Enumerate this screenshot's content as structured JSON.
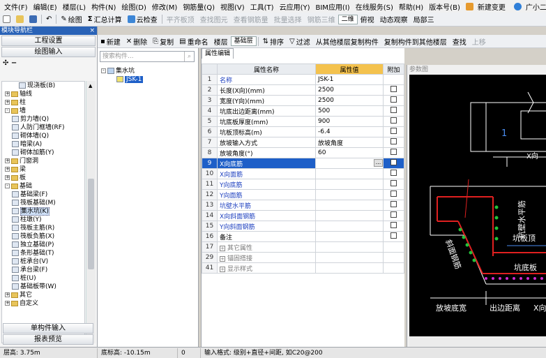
{
  "menu": {
    "items": [
      "文件(F)",
      "编辑(E)",
      "楼层(L)",
      "构件(N)",
      "绘图(D)",
      "修改(M)",
      "钢筋量(Q)",
      "视图(V)",
      "工具(T)",
      "云应用(Y)",
      "BIM应用(I)",
      "在线服务(S)",
      "帮助(H)",
      "版本号(B)"
    ],
    "new_change": "新建变更",
    "user": "广小二"
  },
  "toolbar1": {
    "draw": "绘图",
    "summary": "汇总计算",
    "cloud_check": "云检查",
    "flat_plate": "平齐板顶",
    "find_element": "查找图元",
    "view_rebar": "查看钢筋量",
    "batch_select": "批量选择",
    "rebar_3d": "钢筋三维",
    "view_mode": "二维",
    "view": "俯视",
    "dynamic": "动态观察",
    "local": "局部三"
  },
  "toolbar2": {
    "new": "新建",
    "delete": "删除",
    "copy": "复制",
    "rename": "重命名",
    "floor_label": "楼层",
    "floor_value": "基础层",
    "sort": "排序",
    "filter": "过滤",
    "copy_from_other": "从其他楼层复制构件",
    "copy_to_other": "复制构件到其他楼层",
    "find": "查找",
    "up_move": "上移"
  },
  "nav": {
    "title": "模块导航栏",
    "project_settings": "工程设置",
    "drawing_input": "绘图输入",
    "tree": [
      {
        "label": "现浇板(B)",
        "level": 2,
        "type": "leaf"
      },
      {
        "label": "轴线",
        "level": 0,
        "type": "folder",
        "exp": "+"
      },
      {
        "label": "柱",
        "level": 0,
        "type": "folder",
        "exp": "+"
      },
      {
        "label": "墙",
        "level": 0,
        "type": "folder",
        "exp": "-"
      },
      {
        "label": "剪力墙(Q)",
        "level": 1,
        "type": "leaf"
      },
      {
        "label": "人防门框墙(RF)",
        "level": 1,
        "type": "leaf"
      },
      {
        "label": "砌体墙(Q)",
        "level": 1,
        "type": "leaf"
      },
      {
        "label": "暗梁(A)",
        "level": 1,
        "type": "leaf"
      },
      {
        "label": "砌体加筋(Y)",
        "level": 1,
        "type": "leaf"
      },
      {
        "label": "门窗洞",
        "level": 0,
        "type": "folder",
        "exp": "+"
      },
      {
        "label": "梁",
        "level": 0,
        "type": "folder",
        "exp": "+"
      },
      {
        "label": "板",
        "level": 0,
        "type": "folder",
        "exp": "+"
      },
      {
        "label": "基础",
        "level": 0,
        "type": "folder",
        "exp": "-"
      },
      {
        "label": "基础梁(F)",
        "level": 1,
        "type": "leaf"
      },
      {
        "label": "筏板基础(M)",
        "level": 1,
        "type": "leaf"
      },
      {
        "label": "集水坑(K)",
        "level": 1,
        "type": "leaf",
        "selected": true
      },
      {
        "label": "柱墩(Y)",
        "level": 1,
        "type": "leaf"
      },
      {
        "label": "筏板主筋(R)",
        "level": 1,
        "type": "leaf"
      },
      {
        "label": "筏板负筋(X)",
        "level": 1,
        "type": "leaf"
      },
      {
        "label": "独立基础(P)",
        "level": 1,
        "type": "leaf"
      },
      {
        "label": "条形基础(T)",
        "level": 1,
        "type": "leaf"
      },
      {
        "label": "桩承台(V)",
        "level": 1,
        "type": "leaf"
      },
      {
        "label": "承台梁(F)",
        "level": 1,
        "type": "leaf"
      },
      {
        "label": "桩(U)",
        "level": 1,
        "type": "leaf"
      },
      {
        "label": "基础板带(W)",
        "level": 1,
        "type": "leaf"
      },
      {
        "label": "其它",
        "level": 0,
        "type": "folder",
        "exp": "+"
      },
      {
        "label": "自定义",
        "level": 0,
        "type": "folder",
        "exp": "+"
      }
    ],
    "single_input": "单构件输入",
    "report_preview": "报表预览"
  },
  "components": {
    "search_placeholder": "搜索构件...",
    "root": "集水坑",
    "child": "JSK-1"
  },
  "properties": {
    "tab": "属性编辑",
    "headers": [
      "属性名称",
      "属性值",
      "附加"
    ],
    "rows": [
      {
        "n": "1",
        "name": "名称",
        "value": "JSK-1",
        "blue": true,
        "cb": false
      },
      {
        "n": "2",
        "name": "长度(X向)(mm)",
        "value": "2500",
        "cb": true
      },
      {
        "n": "3",
        "name": "宽度(Y向)(mm)",
        "value": "2500",
        "cb": true
      },
      {
        "n": "4",
        "name": "坑底出边距离(mm)",
        "value": "500",
        "cb": true
      },
      {
        "n": "5",
        "name": "坑底板厚度(mm)",
        "value": "900",
        "cb": true
      },
      {
        "n": "6",
        "name": "坑板顶标高(m)",
        "value": "-6.4",
        "cb": true
      },
      {
        "n": "7",
        "name": "放坡输入方式",
        "value": "放坡角度",
        "cb": true
      },
      {
        "n": "8",
        "name": "放坡角度(°)",
        "value": "60",
        "cb": true
      },
      {
        "n": "9",
        "name": "X向底筋",
        "value": "",
        "blue": true,
        "cb": true,
        "hl": true
      },
      {
        "n": "10",
        "name": "X向面筋",
        "value": "",
        "blue": true,
        "cb": true
      },
      {
        "n": "11",
        "name": "Y向底筋",
        "value": "",
        "blue": true,
        "cb": true
      },
      {
        "n": "12",
        "name": "Y向面筋",
        "value": "",
        "blue": true,
        "cb": true
      },
      {
        "n": "13",
        "name": "坑壁水平筋",
        "value": "",
        "blue": true,
        "cb": true
      },
      {
        "n": "14",
        "name": "X向斜面钢筋",
        "value": "",
        "blue": true,
        "cb": true
      },
      {
        "n": "15",
        "name": "Y向斜面钢筋",
        "value": "",
        "blue": true,
        "cb": true
      },
      {
        "n": "16",
        "name": "备注",
        "value": "",
        "cb": true
      },
      {
        "n": "17",
        "name": "其它属性",
        "value": "",
        "group": true
      },
      {
        "n": "29",
        "name": "锚固搭接",
        "value": "",
        "group": true
      },
      {
        "n": "41",
        "name": "显示样式",
        "value": "",
        "group": true
      }
    ]
  },
  "param_diagram": {
    "title": "参数图",
    "labels": {
      "one": "1",
      "x_dir": "X向",
      "wall_horiz": "坑壁水平筋",
      "plate_top": "坑板顶",
      "slope_rebar": "斜面钢筋",
      "bottom_plate": "坑底板",
      "slope_width": "放坡底宽",
      "edge_dist": "出边距离",
      "x_dir_bottom": "X向"
    }
  },
  "status": {
    "floor_height": "层高: 3.75m",
    "bottom_elev": "底标高: -10.15m",
    "zero": "0",
    "input_format": "输入格式: 级别+直径+间距, 如C20@200"
  }
}
